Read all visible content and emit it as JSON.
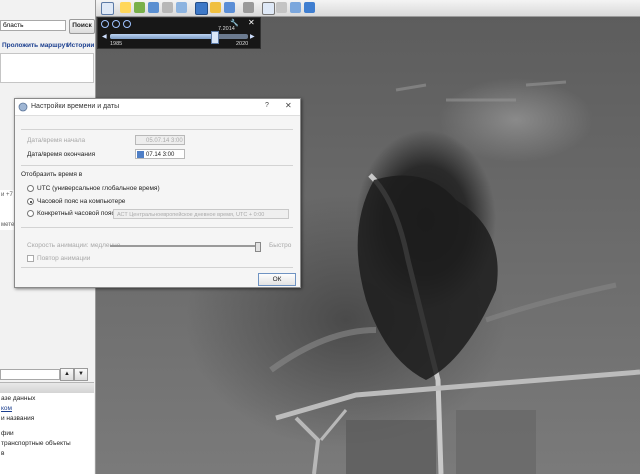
{
  "sidebar": {
    "search_value": "бласть",
    "search_button": "Поиск",
    "route_link": "Проложить маршрут",
    "history_link": "Истории",
    "mid_snippet": [
      "и +7",
      "мете"
    ],
    "layers_items": [
      "азе данных",
      "ком",
      "и названия",
      "фии",
      "транспортные объекты",
      "в"
    ],
    "layers_nav_up": "▲",
    "layers_nav_down": "▼"
  },
  "time_panel": {
    "current_label": "7.2014",
    "start_year": "1985",
    "end_year": "2020",
    "position_fraction": 0.75
  },
  "dialog": {
    "title": "Настройки времени и даты",
    "help": "?",
    "close": "✕",
    "start_label": "Дата/время начала",
    "start_value": "05.07.14 3:00",
    "end_label": "Дата/время окончания",
    "end_value": "07.14 3:00",
    "display_time_label": "Отобразить время в",
    "radio_utc": "UTC (универсальное глобальное время)",
    "radio_computer": "Часовой пояс на компьютере",
    "radio_specific": "Конкретный часовой пояс:",
    "tz_value": "АСТ Центральноевропейское дневное время, UTC + 0:00",
    "speed_label": "Скорость анимации: медленно",
    "speed_fast": "Быстро",
    "loop_label": "Повтор анимации",
    "ok_label": "ОК",
    "speed_fraction": 0.98
  },
  "colors": {
    "accent": "#4f7fc6",
    "time_panel_bg": "#0a0a0a",
    "road": "#c9c9c9"
  }
}
